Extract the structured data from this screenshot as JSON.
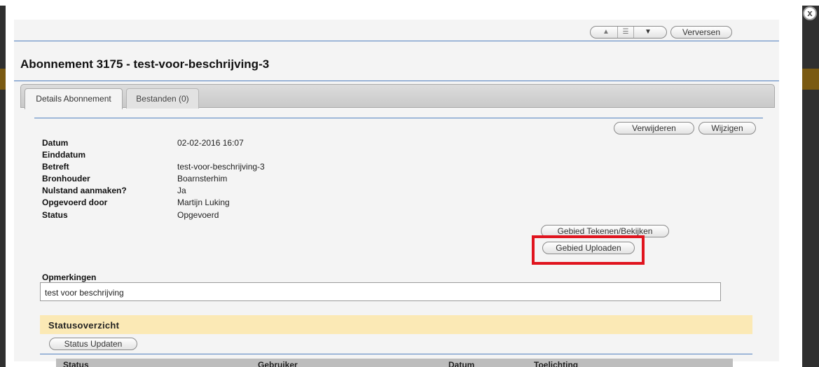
{
  "modal": {
    "close_label": "x"
  },
  "toolbar": {
    "nav_up_label": "▲",
    "nav_menu_label": "☰",
    "nav_down_label": "▼",
    "refresh_label": "Verversen"
  },
  "page": {
    "title": "Abonnement 3175 - test-voor-beschrijving-3"
  },
  "tabs": [
    {
      "label": "Details Abonnement",
      "active": true
    },
    {
      "label": "Bestanden (0)",
      "active": false
    }
  ],
  "actions": {
    "delete_label": "Verwijderen",
    "edit_label": "Wijzigen",
    "draw_area_label": "Gebied Tekenen/Bekijken",
    "upload_area_label": "Gebied Uploaden"
  },
  "details": [
    {
      "label": "Datum",
      "value": "02-02-2016 16:07"
    },
    {
      "label": "Einddatum",
      "value": ""
    },
    {
      "label": "Betreft",
      "value": "test-voor-beschrijving-3"
    },
    {
      "label": "Bronhouder",
      "value": "Boarnsterhim"
    },
    {
      "label": "Nulstand aanmaken?",
      "value": "Ja"
    },
    {
      "label": "Opgevoerd door",
      "value": "Martijn Luking"
    },
    {
      "label": "Status",
      "value": "Opgevoerd"
    }
  ],
  "remarks": {
    "label": "Opmerkingen",
    "value": "test voor beschrijving"
  },
  "status_overview": {
    "title": "Statusoverzicht",
    "update_label": "Status Updaten",
    "columns": [
      "Status",
      "Gebruiker",
      "Datum",
      "Toelichting"
    ]
  },
  "colors": {
    "accent_line": "#4f7fbf",
    "highlight": "#e0141e",
    "section_header": "#fbe9b5"
  }
}
